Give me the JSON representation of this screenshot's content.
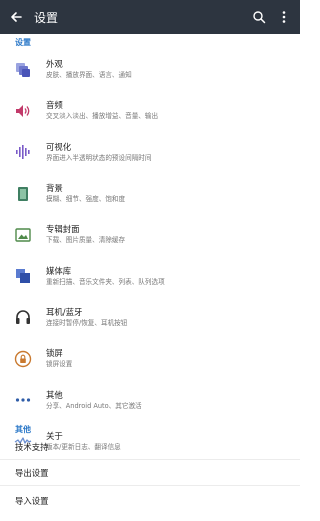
{
  "appbar": {
    "title": "设置",
    "back_icon": "arrow-left-icon",
    "search_icon": "search-icon",
    "more_icon": "more-vertical-icon"
  },
  "sections": {
    "settings_header": "设置",
    "other_header": "其他"
  },
  "items": [
    {
      "title": "外观",
      "subtitle": "皮肤、播放界面、语言、通知",
      "icon": "appearance-icon"
    },
    {
      "title": "音频",
      "subtitle": "交叉淡入淡出、播放增益、音量、输出",
      "icon": "audio-icon"
    },
    {
      "title": "可视化",
      "subtitle": "界面进入半透明状态的预设间隔时间",
      "icon": "visualizer-icon"
    },
    {
      "title": "背景",
      "subtitle": "模糊、细节、强度、饱和度",
      "icon": "background-icon"
    },
    {
      "title": "专辑封面",
      "subtitle": "下载、图片质量、清除缓存",
      "icon": "album-art-icon"
    },
    {
      "title": "媒体库",
      "subtitle": "重新扫描、音乐文件夹、列表、队列选项",
      "icon": "library-icon"
    },
    {
      "title": "耳机/蓝牙",
      "subtitle": "连接时暂停/恢复、耳机按钮",
      "icon": "headphones-icon"
    },
    {
      "title": "锁屏",
      "subtitle": "锁屏设置",
      "icon": "lock-icon"
    },
    {
      "title": "其他",
      "subtitle": "分享、Android Auto、其它激活",
      "icon": "more-horizontal-icon"
    },
    {
      "title": "关于",
      "subtitle": "版本/更新日志、翻译信息",
      "icon": "about-wave-icon"
    }
  ],
  "other_items": [
    {
      "label": "技术支持"
    },
    {
      "label": "导出设置"
    },
    {
      "label": "导入设置"
    }
  ],
  "colors": {
    "appbar": "#2d3540",
    "accent": "#2b78c8"
  }
}
